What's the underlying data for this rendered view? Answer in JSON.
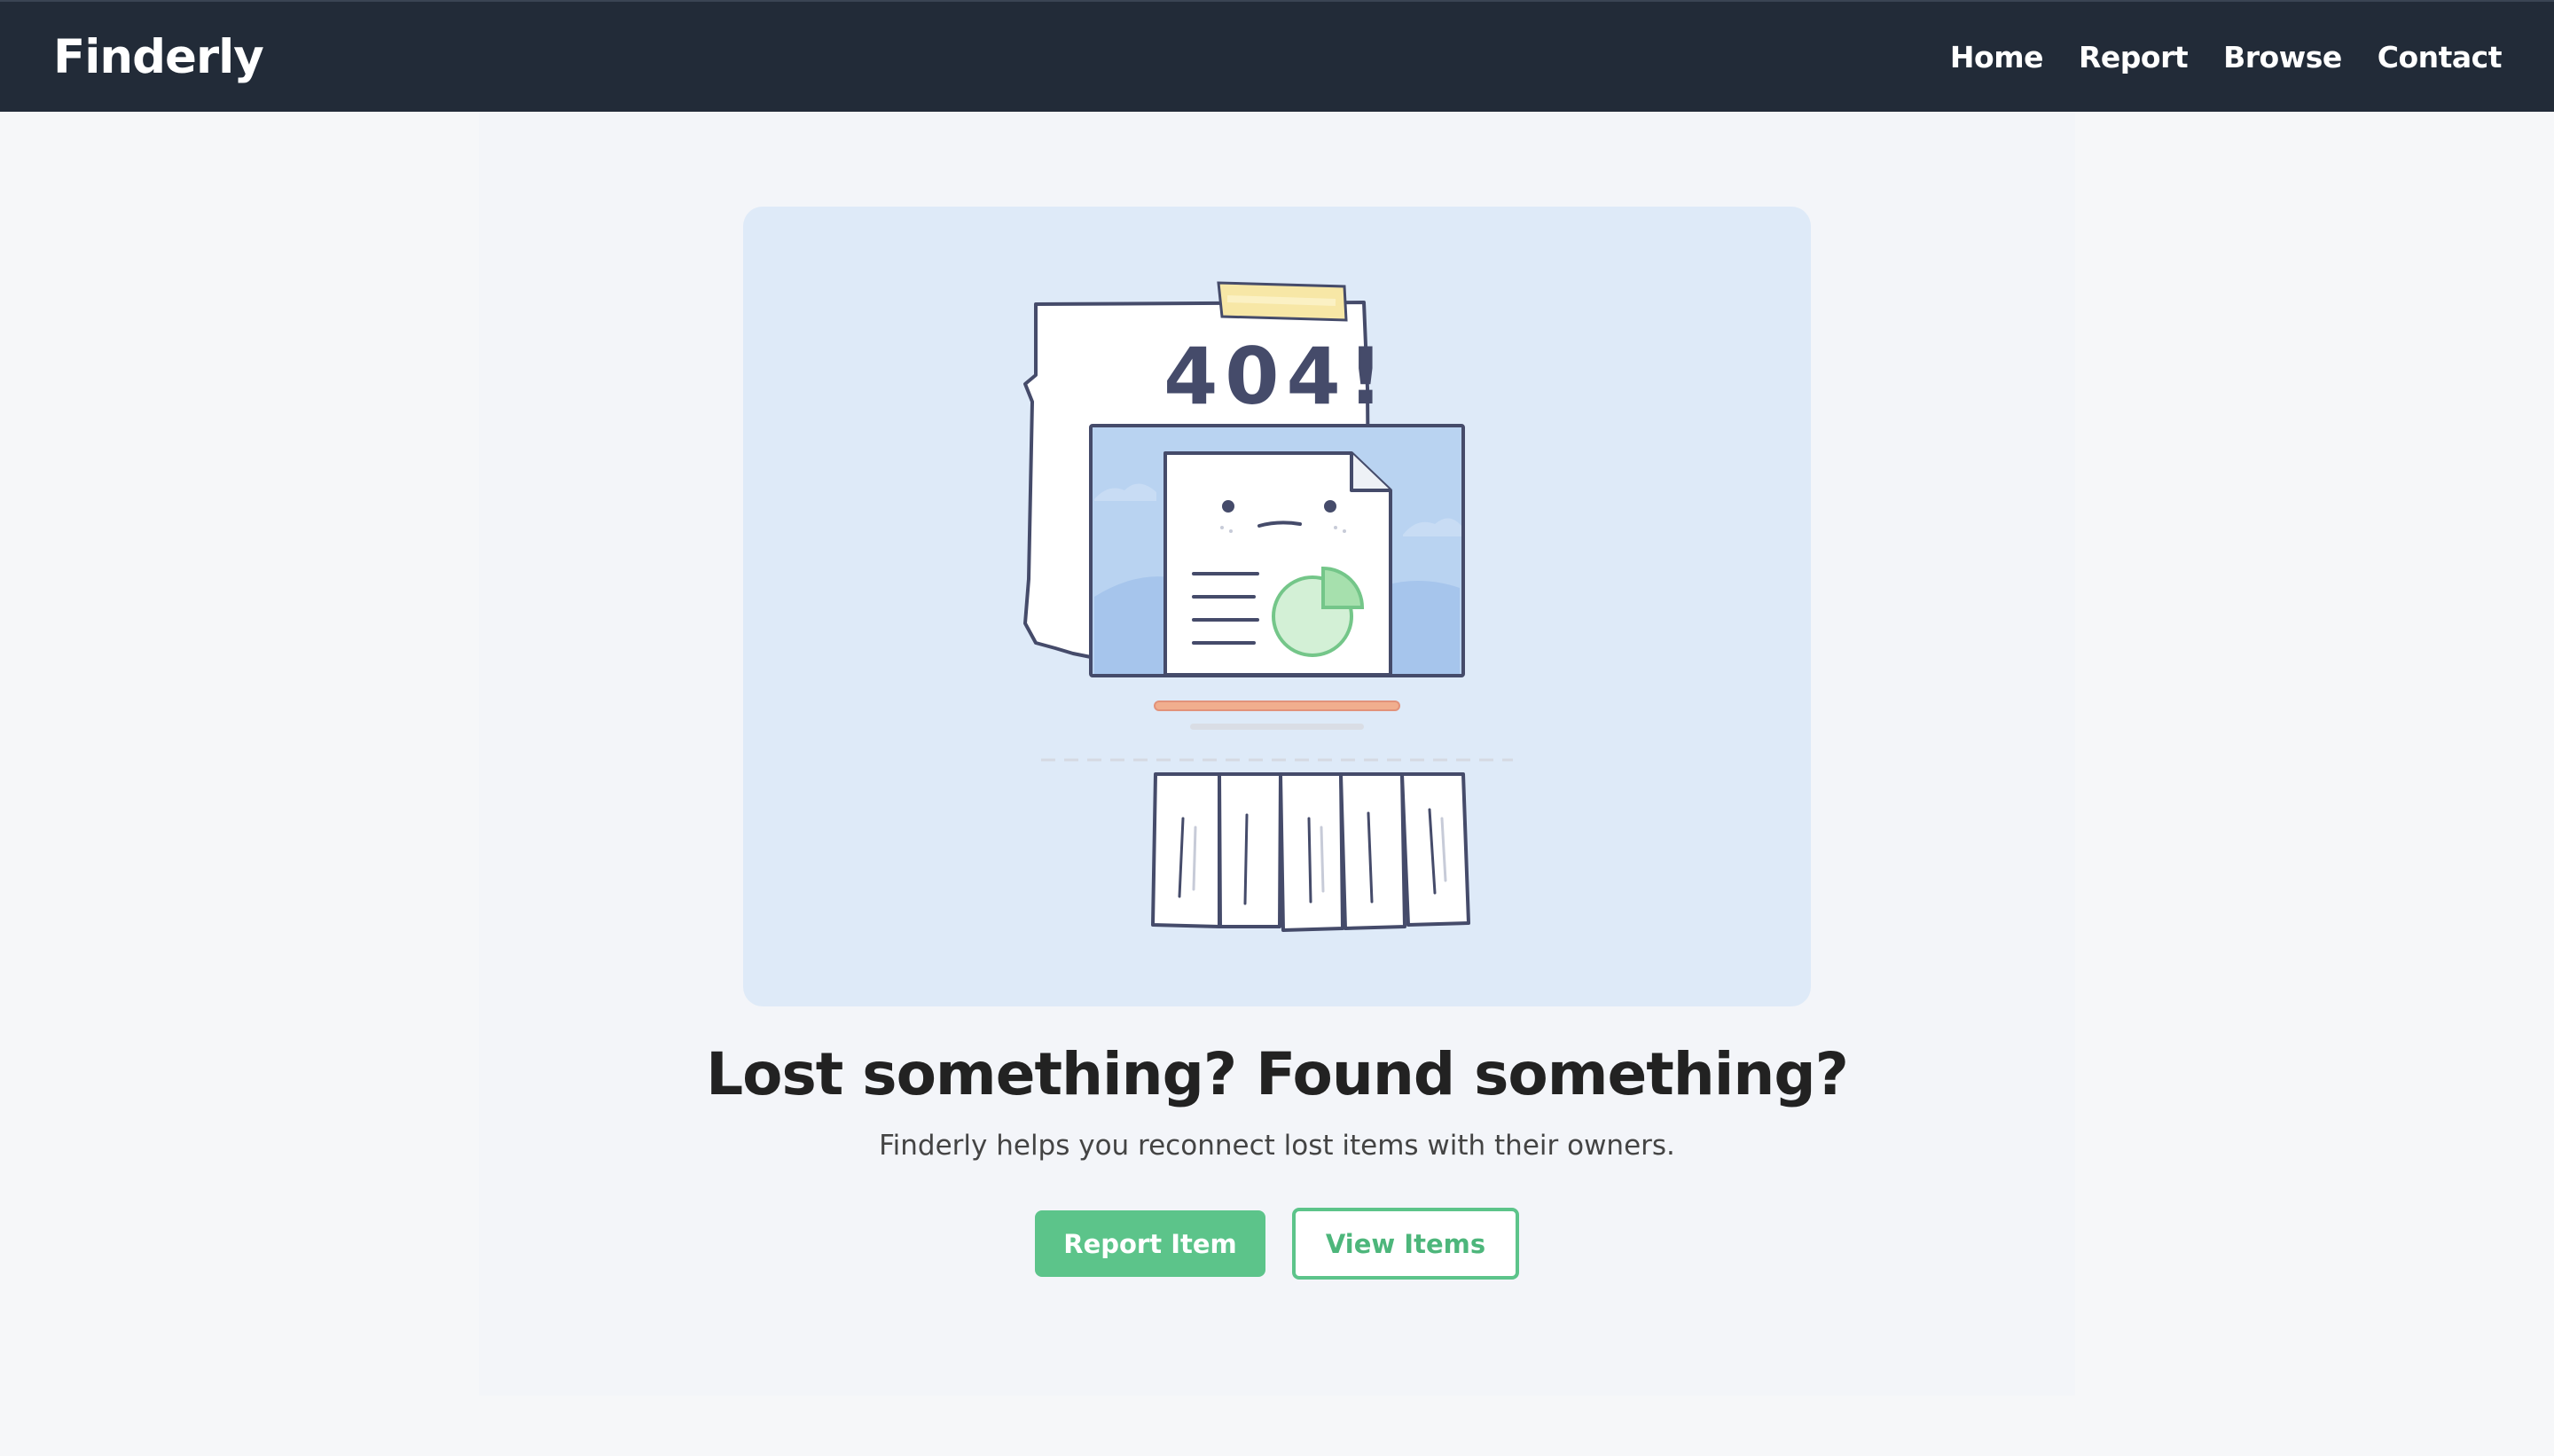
{
  "brand": {
    "name": "Finderly"
  },
  "nav": {
    "items": [
      {
        "label": "Home"
      },
      {
        "label": "Report"
      },
      {
        "label": "Browse"
      },
      {
        "label": "Contact"
      }
    ]
  },
  "hero": {
    "illustration": {
      "error_code": "404!",
      "icon": "torn-paper-document-icon"
    },
    "title": "Lost something? Found something?",
    "subtitle": "Finderly helps you reconnect lost items with their owners.",
    "primary_button": "Report Item",
    "secondary_button": "View Items"
  },
  "colors": {
    "navbar": "#222b38",
    "accent": "#5cc48a",
    "card_bg": "#deeaf8",
    "page_bg": "#f6f7f9"
  }
}
